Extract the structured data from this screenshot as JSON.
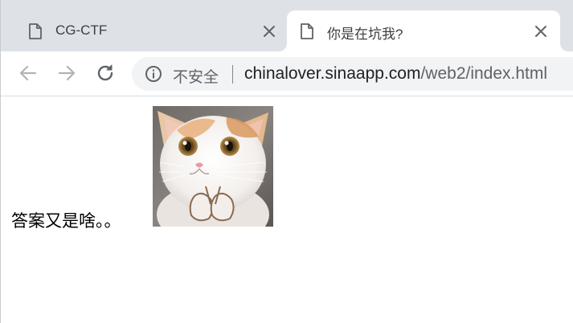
{
  "tabs": [
    {
      "title": "CG-CTF",
      "active": false
    },
    {
      "title": "你是在坑我?",
      "active": true
    }
  ],
  "toolbar": {
    "security_label": "不安全",
    "url_host": "chinalover.sinaapp.com",
    "url_path": "/web2/index.html"
  },
  "page": {
    "text": "答案又是啥。。",
    "image_alt": "cat-meme"
  },
  "icons": {
    "tab_page": "page-icon",
    "tab_close": "close-icon",
    "back": "back-arrow-icon",
    "forward": "forward-arrow-icon",
    "reload": "reload-icon",
    "info": "info-icon"
  },
  "colors": {
    "tabstrip": "#dee1e6",
    "omnibox": "#f1f3f4",
    "icon": "#5f6368"
  }
}
